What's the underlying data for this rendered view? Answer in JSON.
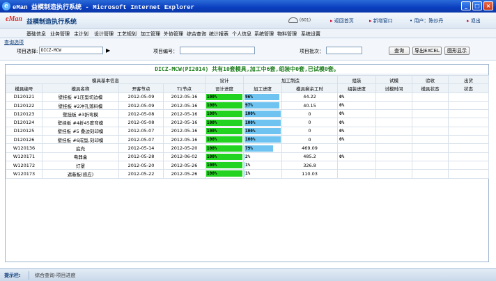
{
  "window": {
    "title": "eMan 益模制造执行系统 - Microsoft Internet Explorer",
    "buttons": [
      "_",
      "□",
      "×"
    ]
  },
  "app": {
    "logo": "eMan",
    "title": "益模制造执行系统",
    "phone_text": "(601)",
    "links": {
      "home": "返回首页",
      "new_window": "新增窗口",
      "user": "• 用户：陈炒丹",
      "logout": "退出"
    }
  },
  "menu": [
    "基础信息",
    "业务管理",
    "主计划",
    "设计管理",
    "工艺规划",
    "加工管理",
    "外协管理",
    "综合查询",
    "统计报表",
    "个人信息",
    "系统管理",
    "物料管理",
    "系统设置"
  ],
  "query": {
    "tab": "查询选项",
    "project_label": "项目选择:",
    "project_value": "DICZ-MCW",
    "project_no_label": "项目编号：",
    "project_no_value": "",
    "batch_label": "项目批次：",
    "batch_value": "",
    "query_button": "查询",
    "export_button": "导出EXCEL",
    "chart_button": "图形显示"
  },
  "banner": "DICZ-MCW(PI2014) 共有10套模具,加工中6套,组装中0套,已试模0套。",
  "table": {
    "group_headers": [
      "模具基本信息",
      "设计",
      "加工制造",
      "组装",
      "试模",
      "验收",
      "出货"
    ],
    "columns": [
      "模具编号",
      "模具名称",
      "开客节点",
      "T1节点",
      "设计进度",
      "加工进度",
      "模具剩余工时",
      "组装进度",
      "试模时间",
      "模具状态",
      "状态"
    ],
    "rows": [
      {
        "no": "D120121",
        "name": "壁挂板 #1压型切边模",
        "start": "2012-05-09",
        "t1": "2012-05-16",
        "design": "100%",
        "design_pct": 100,
        "machining": "96%",
        "machining_pct": 96,
        "remaining": "44.22",
        "assembly": "0%"
      },
      {
        "no": "D120122",
        "name": "壁挂板 #2冲孔落料模",
        "start": "2012-05-09",
        "t1": "2012-05-16",
        "design": "100%",
        "design_pct": 100,
        "machining": "97%",
        "machining_pct": 97,
        "remaining": "40.15",
        "assembly": "0%"
      },
      {
        "no": "D120123",
        "name": "壁挂板 #3折弯模",
        "start": "2012-05-08",
        "t1": "2012-05-16",
        "design": "100%",
        "design_pct": 100,
        "machining": "100%",
        "machining_pct": 100,
        "remaining": "0",
        "assembly": "0%"
      },
      {
        "no": "D120124",
        "name": "壁挂板 #4折45度弯模",
        "start": "2012-05-08",
        "t1": "2012-05-16",
        "design": "100%",
        "design_pct": 100,
        "machining": "100%",
        "machining_pct": 100,
        "remaining": "0",
        "assembly": "0%"
      },
      {
        "no": "D120125",
        "name": "壁挂板 #5 叠边刻印模",
        "start": "2012-05-07",
        "t1": "2012-05-16",
        "design": "100%",
        "design_pct": 100,
        "machining": "100%",
        "machining_pct": 100,
        "remaining": "0",
        "assembly": "0%"
      },
      {
        "no": "D120126",
        "name": "壁挂板 #6成型,刻印模",
        "start": "2012-05-07",
        "t1": "2012-05-16",
        "design": "100%",
        "design_pct": 100,
        "machining": "100%",
        "machining_pct": 100,
        "remaining": "0",
        "assembly": "0%"
      },
      {
        "no": "W120136",
        "name": "底壳",
        "start": "2012-05-14",
        "t1": "2012-05-20",
        "design": "100%",
        "design_pct": 100,
        "machining": "79%",
        "machining_pct": 79,
        "remaining": "469.09",
        "assembly": ""
      },
      {
        "no": "W120171",
        "name": "电器盒",
        "start": "2012-05-28",
        "t1": "2012-06-02",
        "design": "100%",
        "design_pct": 100,
        "machining": "2%",
        "machining_pct": 2,
        "remaining": "485.2",
        "assembly": "0%"
      },
      {
        "no": "W120172",
        "name": "灯罩",
        "start": "2012-05-20",
        "t1": "2012-05-26",
        "design": "100%",
        "design_pct": 100,
        "machining": "1%",
        "machining_pct": 1,
        "remaining": "326.8",
        "assembly": ""
      },
      {
        "no": "W120173",
        "name": "遮蔽板(感应)",
        "start": "2012-05-22",
        "t1": "2012-05-26",
        "design": "100%",
        "design_pct": 100,
        "machining": "1%",
        "machining_pct": 1,
        "remaining": "110.03",
        "assembly": ""
      }
    ]
  },
  "status": {
    "label": "提示栏:",
    "text": "综合查询-项目进度"
  },
  "colors": {
    "design_bar": "#22d322",
    "machining_bar": "#6fc3f0",
    "assembly_bar": "#6fc3f0",
    "banner_text": "#1c7d1c"
  }
}
